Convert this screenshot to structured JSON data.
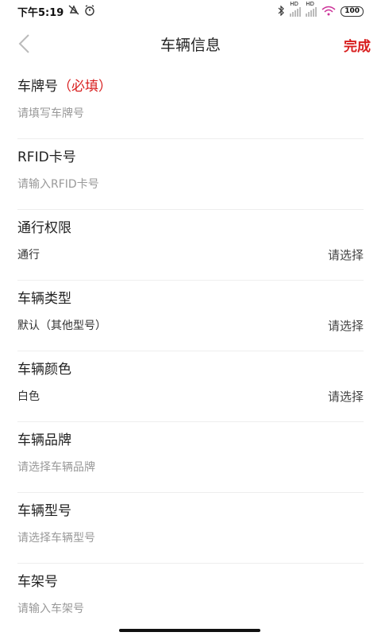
{
  "status_bar": {
    "time": "下午5:19",
    "left_icons": [
      "mute-icon",
      "alarm-icon"
    ],
    "signal_1_label": "HD",
    "signal_2_label": "HD",
    "battery": "100"
  },
  "nav": {
    "back_icon": "chevron-left-icon",
    "title": "车辆信息",
    "done": "完成"
  },
  "form": {
    "plate": {
      "label": "车牌号",
      "required": "（必填）",
      "placeholder": "请填写车牌号"
    },
    "rfid": {
      "label": "RFID卡号",
      "placeholder": "请输入RFID卡号"
    },
    "access": {
      "label": "通行权限",
      "value": "通行",
      "select": "请选择"
    },
    "type": {
      "label": "车辆类型",
      "value": "默认（其他型号）",
      "select": "请选择"
    },
    "color": {
      "label": "车辆颜色",
      "value": "白色",
      "select": "请选择"
    },
    "brand": {
      "label": "车辆品牌",
      "placeholder": "请选择车辆品牌"
    },
    "model": {
      "label": "车辆型号",
      "placeholder": "请选择车辆型号"
    },
    "frame": {
      "label": "车架号",
      "placeholder": "请输入车架号"
    }
  },
  "colors": {
    "accent": "#d81e1e",
    "placeholder": "#999999",
    "divider": "#eeeeee"
  }
}
